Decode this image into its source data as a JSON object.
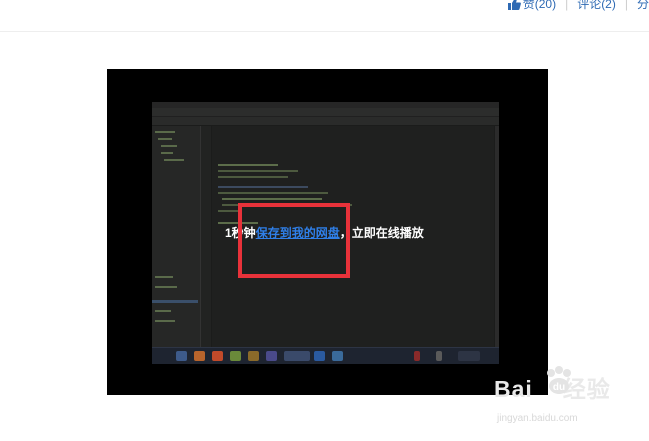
{
  "header": {
    "like_label": "赞(20)",
    "comment_label": "评论(2)",
    "share_label": "分"
  },
  "video": {
    "prompt_prefix": "1秒钟",
    "prompt_link": "保存到我的网盘",
    "prompt_suffix": "，立即在线播放"
  },
  "watermark": {
    "logo_text": "Baidu 经验",
    "url": "jingyan.baidu.com"
  },
  "colors": {
    "link_blue": "#2e6ab4",
    "highlight_red": "#e8323a",
    "video_bg": "#000000"
  }
}
